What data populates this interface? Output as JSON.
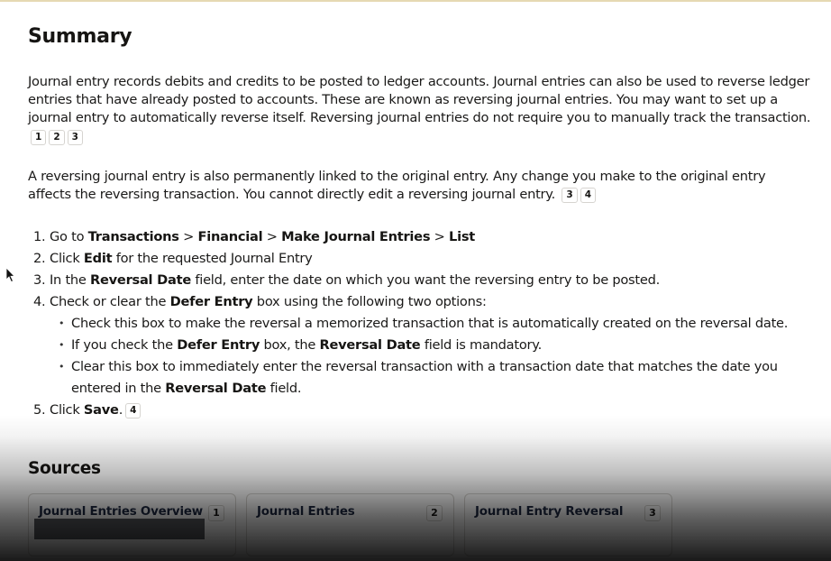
{
  "summary": {
    "title": "Summary",
    "para1": {
      "text": "Journal entry records debits and credits to be posted to ledger accounts. Journal entries can also be used to reverse ledger entries that have already posted to accounts. These are known as reversing journal entries. You may want to set up a journal entry to automatically reverse itself. Reversing journal entries do not require you to manually track the transaction.",
      "citations": [
        "1",
        "2",
        "3"
      ]
    },
    "para2": {
      "text": "A reversing journal entry is also permanently linked to the original entry. Any change you make to the original entry affects the reversing transaction. You cannot directly edit a reversing journal entry.",
      "citations": [
        "3",
        "4"
      ]
    }
  },
  "steps": [
    {
      "num": "1.",
      "parts": [
        [
          "Go to ",
          false
        ],
        [
          "Transactions",
          true
        ],
        [
          " > ",
          false
        ],
        [
          "Financial",
          true
        ],
        [
          " > ",
          false
        ],
        [
          "Make Journal Entries",
          true
        ],
        [
          " > ",
          false
        ],
        [
          "List",
          true
        ]
      ]
    },
    {
      "num": "2.",
      "parts": [
        [
          "Click ",
          false
        ],
        [
          "Edit",
          true
        ],
        [
          " for the requested Journal Entry",
          false
        ]
      ]
    },
    {
      "num": "3.",
      "parts": [
        [
          "In the ",
          false
        ],
        [
          "Reversal Date",
          true
        ],
        [
          " field, enter the date on which you want the reversing entry to be posted.",
          false
        ]
      ]
    },
    {
      "num": "4.",
      "parts": [
        [
          "Check or clear the ",
          false
        ],
        [
          "Defer Entry",
          true
        ],
        [
          " box using the following two options:",
          false
        ]
      ],
      "sub": [
        [
          [
            "Check this box to make the reversal a memorized transaction that is automatically created on the reversal date.",
            false
          ]
        ],
        [
          [
            "If you check the ",
            false
          ],
          [
            "Defer Entry",
            true
          ],
          [
            " box, the ",
            false
          ],
          [
            "Reversal Date",
            true
          ],
          [
            " field is mandatory.",
            false
          ]
        ],
        [
          [
            "Clear this box to immediately enter the reversal transaction with a transaction date that matches the date you entered in the ",
            false
          ],
          [
            "Reversal Date",
            true
          ],
          [
            " field.",
            false
          ]
        ]
      ]
    },
    {
      "num": "5.",
      "parts": [
        [
          "Click ",
          false
        ],
        [
          "Save",
          true
        ],
        [
          ".",
          false
        ]
      ],
      "citations": [
        "4"
      ]
    }
  ],
  "sources": {
    "title": "Sources",
    "cards": [
      {
        "title": "Journal Entries Overview",
        "badge": "1"
      },
      {
        "title": "Journal Entries",
        "badge": "2"
      },
      {
        "title": "Journal Entry Reversal",
        "badge": "3"
      }
    ]
  },
  "colors": {
    "top_rule": "#e6d9b3",
    "card_title": "#1f2a44"
  }
}
